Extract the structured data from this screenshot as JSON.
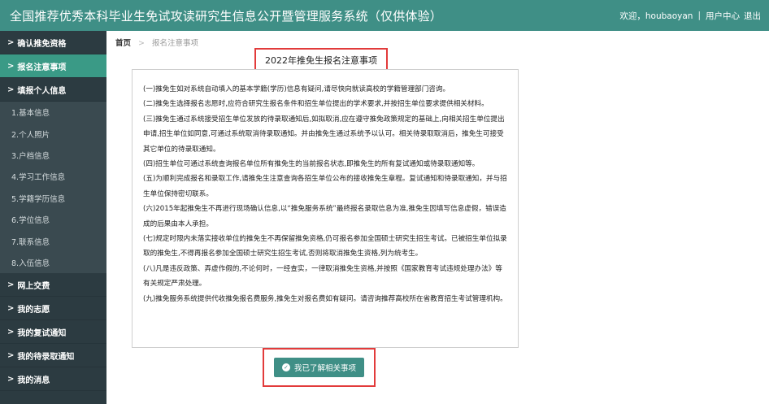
{
  "header": {
    "title": "全国推荐优秀本科毕业生免试攻读研究生信息公开暨管理服务系统（仅供体验）",
    "welcome": "欢迎，houbaoyan",
    "sep": "|",
    "user_center": "用户中心",
    "logout": "退出"
  },
  "sidebar": {
    "chevron": ">",
    "items": [
      {
        "label": "确认推免资格"
      },
      {
        "label": "报名注意事项"
      },
      {
        "label": "填报个人信息"
      }
    ],
    "sub_items": [
      {
        "label": "1.基本信息"
      },
      {
        "label": "2.个人照片"
      },
      {
        "label": "3.户档信息"
      },
      {
        "label": "4.学习工作信息"
      },
      {
        "label": "5.学籍学历信息"
      },
      {
        "label": "6.学位信息"
      },
      {
        "label": "7.联系信息"
      },
      {
        "label": "8.入伍信息"
      }
    ],
    "bottom_items": [
      {
        "label": "网上交费"
      },
      {
        "label": "我的志愿"
      },
      {
        "label": "我的复试通知"
      },
      {
        "label": "我的待录取通知"
      },
      {
        "label": "我的消息"
      }
    ]
  },
  "breadcrumb": {
    "home": "首页",
    "sep": ">",
    "current": "报名注意事项"
  },
  "notice": {
    "title": "2022年推免生报名注意事项",
    "paragraphs": [
      "(一)推免生如对系统自动填入的基本学籍(学历)信息有疑问,请尽快向就读高校的学籍管理部门咨询。",
      "(二)推免生选择报名志愿时,应符合研究生报名条件和招生单位提出的学术要求,并按招生单位要求提供相关材料。",
      "(三)推免生通过系统接受招生单位发放的待录取通知后,如拟取消,应在遵守推免政策规定的基础上,向相关招生单位提出申请,招生单位如同意,可通过系统取消待录取通知。并由推免生通过系统予以认可。相关待录取取消后，推免生可接受其它单位的待录取通知。",
      "(四)招生单位可通过系统查询报名单位所有推免生的当前报名状态,即推免生的所有复试通知或待录取通知等。",
      "(五)为顺利完成报名和录取工作,请推免生注意查询各招生单位公布的接收推免生章程。复试通知和待录取通知，并与招生单位保持密切联系。",
      "(六)2015年起推免生不再进行现场确认信息,以“推免服务系统”最终报名录取信息为准,推免生因填写信息虚假，错误造成的后果由本人承担。",
      "(七)规定时限内未落实接收单位的推免生不再保留推免资格,仍可报名参加全国硕士研究生招生考试。已被招生单位拟录取的推免生,不得再报名参加全国硕士研究生招生考试,否则将取消推免生资格,列为统考生。",
      "(八)凡是违反政策、弄虚作假的,不论何时，一经查实，一律取消推免生资格,并按照《国家教育考试违规处理办法》等有关规定严肃处理。",
      "(九)推免服务系统提供代收推免报名费服务,推免生对报名费如有疑问。请咨询推荐高校所在省教育招生考试管理机构。"
    ]
  },
  "confirm": {
    "icon": "✓",
    "label": "我已了解相关事项"
  },
  "colors": {
    "header_bg": "#3f8f86",
    "sidebar_bg": "#2c3b41",
    "active_item": "#3a9a86",
    "highlight_border": "#e23b3b"
  }
}
